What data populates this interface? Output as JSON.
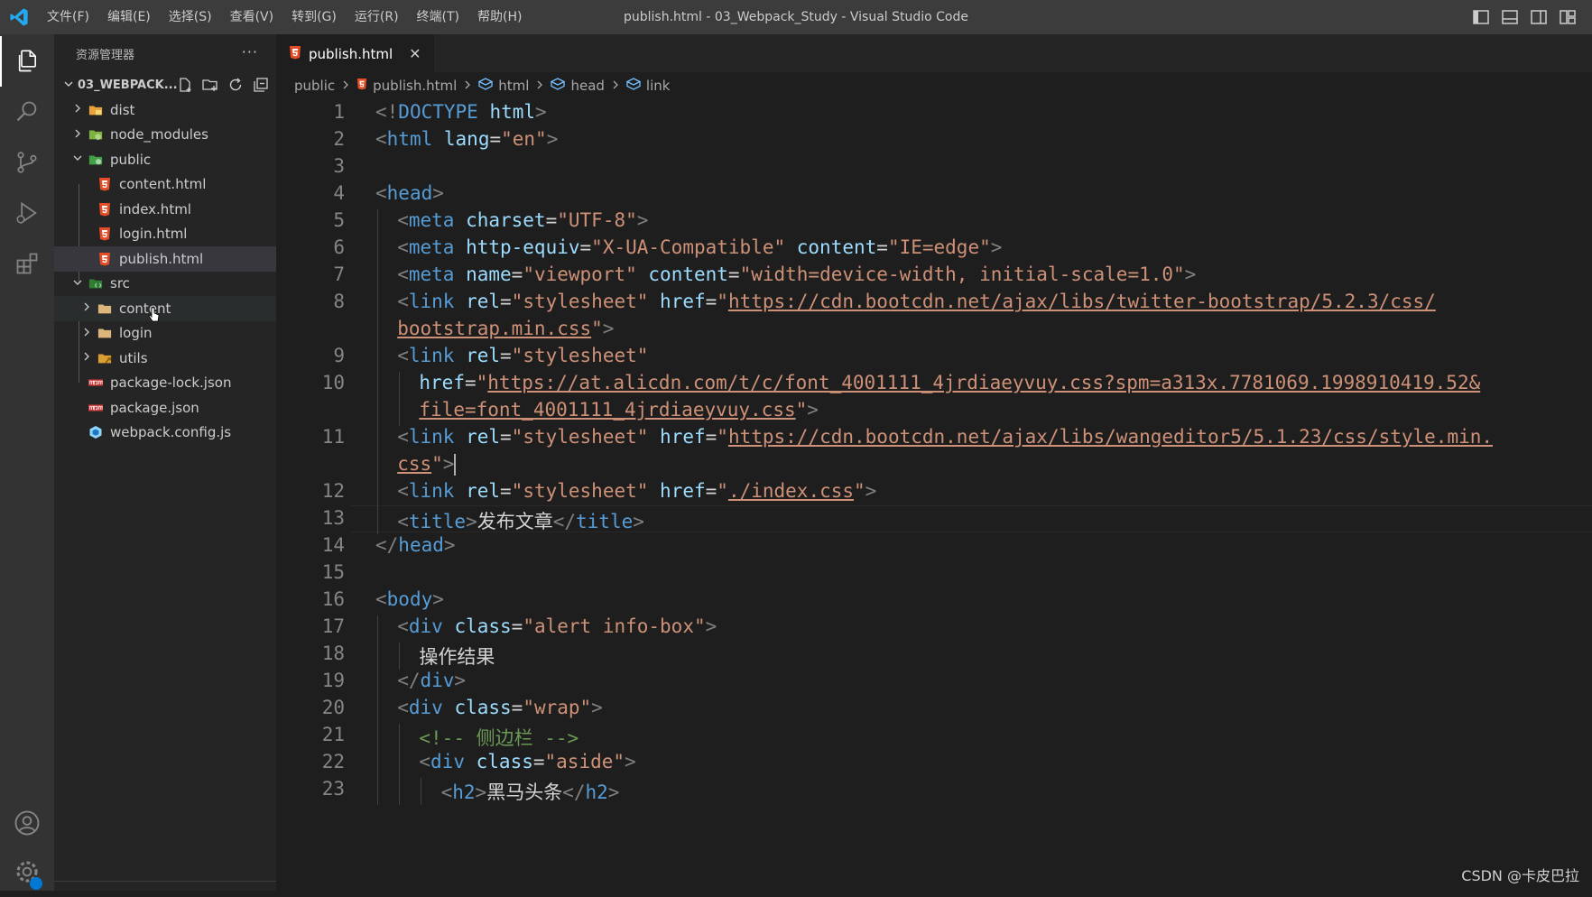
{
  "window": {
    "title": "publish.html - 03_Webpack_Study - Visual Studio Code",
    "menu": [
      "文件(F)",
      "编辑(E)",
      "选择(S)",
      "查看(V)",
      "转到(G)",
      "运行(R)",
      "终端(T)",
      "帮助(H)"
    ]
  },
  "sidebar": {
    "title": "资源管理器",
    "more": "···",
    "folder": "03_WEBPACK...",
    "tree": [
      {
        "label": "dist",
        "type": "folder-dist",
        "depth": 0,
        "expanded": false
      },
      {
        "label": "node_modules",
        "type": "folder-node",
        "depth": 0,
        "expanded": false
      },
      {
        "label": "public",
        "type": "folder-public",
        "depth": 0,
        "expanded": true
      },
      {
        "label": "content.html",
        "type": "html",
        "depth": 1
      },
      {
        "label": "index.html",
        "type": "html",
        "depth": 1
      },
      {
        "label": "login.html",
        "type": "html",
        "depth": 1
      },
      {
        "label": "publish.html",
        "type": "html",
        "depth": 1,
        "selected": true
      },
      {
        "label": "src",
        "type": "folder-src",
        "depth": 0,
        "expanded": true
      },
      {
        "label": "content",
        "type": "folder",
        "depth": 1,
        "expanded": false,
        "hover": true
      },
      {
        "label": "login",
        "type": "folder",
        "depth": 1,
        "expanded": false
      },
      {
        "label": "utils",
        "type": "folder-utils",
        "depth": 1,
        "expanded": false
      },
      {
        "label": "package-lock.json",
        "type": "npm",
        "depth": 0
      },
      {
        "label": "package.json",
        "type": "npm",
        "depth": 0
      },
      {
        "label": "webpack.config.js",
        "type": "webpack",
        "depth": 0
      }
    ]
  },
  "editor": {
    "tab": {
      "label": "publish.html",
      "close": "✕"
    },
    "breadcrumb": [
      "public",
      "publish.html",
      "html",
      "head",
      "link"
    ],
    "lines": [
      {
        "n": "1",
        "indent": 0,
        "tokens": [
          [
            "b",
            "<!"
          ],
          [
            "tag",
            "DOCTYPE"
          ],
          [
            "txt",
            " "
          ],
          [
            "attr",
            "html"
          ],
          [
            "b",
            ">"
          ]
        ]
      },
      {
        "n": "2",
        "indent": 0,
        "tokens": [
          [
            "b",
            "<"
          ],
          [
            "tag",
            "html"
          ],
          [
            "txt",
            " "
          ],
          [
            "attr",
            "lang"
          ],
          [
            "txt",
            "="
          ],
          [
            "str",
            "\"en\""
          ],
          [
            "b",
            ">"
          ]
        ]
      },
      {
        "n": "3",
        "indent": 0,
        "tokens": []
      },
      {
        "n": "4",
        "indent": 0,
        "tokens": [
          [
            "b",
            "<"
          ],
          [
            "tag",
            "head"
          ],
          [
            "b",
            ">"
          ]
        ]
      },
      {
        "n": "5",
        "indent": 1,
        "tokens": [
          [
            "b",
            "<"
          ],
          [
            "tag",
            "meta"
          ],
          [
            "txt",
            " "
          ],
          [
            "attr",
            "charset"
          ],
          [
            "txt",
            "="
          ],
          [
            "str",
            "\"UTF-8\""
          ],
          [
            "b",
            ">"
          ]
        ]
      },
      {
        "n": "6",
        "indent": 1,
        "tokens": [
          [
            "b",
            "<"
          ],
          [
            "tag",
            "meta"
          ],
          [
            "txt",
            " "
          ],
          [
            "attr",
            "http-equiv"
          ],
          [
            "txt",
            "="
          ],
          [
            "str",
            "\"X-UA-Compatible\""
          ],
          [
            "txt",
            " "
          ],
          [
            "attr",
            "content"
          ],
          [
            "txt",
            "="
          ],
          [
            "str",
            "\"IE=edge\""
          ],
          [
            "b",
            ">"
          ]
        ]
      },
      {
        "n": "7",
        "indent": 1,
        "tokens": [
          [
            "b",
            "<"
          ],
          [
            "tag",
            "meta"
          ],
          [
            "txt",
            " "
          ],
          [
            "attr",
            "name"
          ],
          [
            "txt",
            "="
          ],
          [
            "str",
            "\"viewport\""
          ],
          [
            "txt",
            " "
          ],
          [
            "attr",
            "content"
          ],
          [
            "txt",
            "="
          ],
          [
            "str",
            "\"width=device-width, initial-scale=1.0\""
          ],
          [
            "b",
            ">"
          ]
        ]
      },
      {
        "n": "8",
        "indent": 1,
        "tokens": [
          [
            "b",
            "<"
          ],
          [
            "tag",
            "link"
          ],
          [
            "txt",
            " "
          ],
          [
            "attr",
            "rel"
          ],
          [
            "txt",
            "="
          ],
          [
            "str",
            "\"stylesheet\""
          ],
          [
            "txt",
            " "
          ],
          [
            "attr",
            "href"
          ],
          [
            "txt",
            "="
          ],
          [
            "str",
            "\""
          ],
          [
            "url",
            "https://cdn.bootcdn.net/ajax/libs/twitter-bootstrap/5.2.3/css/"
          ]
        ]
      },
      {
        "n": "",
        "indent": 1,
        "tokens": [
          [
            "url",
            "bootstrap.min.css"
          ],
          [
            "str",
            "\""
          ],
          [
            "b",
            ">"
          ]
        ]
      },
      {
        "n": "9",
        "indent": 1,
        "tokens": [
          [
            "b",
            "<"
          ],
          [
            "tag",
            "link"
          ],
          [
            "txt",
            " "
          ],
          [
            "attr",
            "rel"
          ],
          [
            "txt",
            "="
          ],
          [
            "str",
            "\"stylesheet\""
          ]
        ]
      },
      {
        "n": "10",
        "indent": 2,
        "tokens": [
          [
            "attr",
            "href"
          ],
          [
            "txt",
            "="
          ],
          [
            "str",
            "\""
          ],
          [
            "url",
            "https://at.alicdn.com/t/c/font_4001111_4jrdiaeyvuy.css?spm=a313x.7781069.1998910419.52&"
          ]
        ]
      },
      {
        "n": "",
        "indent": 2,
        "tokens": [
          [
            "url",
            "file=font_4001111_4jrdiaeyvuy.css"
          ],
          [
            "str",
            "\""
          ],
          [
            "b",
            ">"
          ]
        ]
      },
      {
        "n": "11",
        "indent": 1,
        "tokens": [
          [
            "b",
            "<"
          ],
          [
            "tag",
            "link"
          ],
          [
            "txt",
            " "
          ],
          [
            "attr",
            "rel"
          ],
          [
            "txt",
            "="
          ],
          [
            "str",
            "\"stylesheet\""
          ],
          [
            "txt",
            " "
          ],
          [
            "attr",
            "href"
          ],
          [
            "txt",
            "="
          ],
          [
            "str",
            "\""
          ],
          [
            "url",
            "https://cdn.bootcdn.net/ajax/libs/wangeditor5/5.1.23/css/style.min."
          ]
        ]
      },
      {
        "n": "",
        "indent": 1,
        "cursor": true,
        "tokens": [
          [
            "url",
            "css"
          ],
          [
            "str",
            "\""
          ],
          [
            "b",
            ">"
          ]
        ]
      },
      {
        "n": "12",
        "indent": 1,
        "tokens": [
          [
            "b",
            "<"
          ],
          [
            "tag",
            "link"
          ],
          [
            "txt",
            " "
          ],
          [
            "attr",
            "rel"
          ],
          [
            "txt",
            "="
          ],
          [
            "str",
            "\"stylesheet\""
          ],
          [
            "txt",
            " "
          ],
          [
            "attr",
            "href"
          ],
          [
            "txt",
            "="
          ],
          [
            "str",
            "\""
          ],
          [
            "url",
            "./index.css"
          ],
          [
            "str",
            "\""
          ],
          [
            "b",
            ">"
          ]
        ]
      },
      {
        "n": "13",
        "indent": 1,
        "tokens": [
          [
            "b",
            "<"
          ],
          [
            "tag",
            "title"
          ],
          [
            "b",
            ">"
          ],
          [
            "txt",
            "发布文章"
          ],
          [
            "b",
            "</"
          ],
          [
            "tag",
            "title"
          ],
          [
            "b",
            ">"
          ]
        ]
      },
      {
        "n": "14",
        "indent": 0,
        "tokens": [
          [
            "b",
            "</"
          ],
          [
            "tag",
            "head"
          ],
          [
            "b",
            ">"
          ]
        ]
      },
      {
        "n": "15",
        "indent": 0,
        "tokens": []
      },
      {
        "n": "16",
        "indent": 0,
        "tokens": [
          [
            "b",
            "<"
          ],
          [
            "tag",
            "body"
          ],
          [
            "b",
            ">"
          ]
        ]
      },
      {
        "n": "17",
        "indent": 1,
        "tokens": [
          [
            "b",
            "<"
          ],
          [
            "tag",
            "div"
          ],
          [
            "txt",
            " "
          ],
          [
            "attr",
            "class"
          ],
          [
            "txt",
            "="
          ],
          [
            "str",
            "\"alert info-box\""
          ],
          [
            "b",
            ">"
          ]
        ]
      },
      {
        "n": "18",
        "indent": 2,
        "tokens": [
          [
            "txt",
            "操作结果"
          ]
        ]
      },
      {
        "n": "19",
        "indent": 1,
        "tokens": [
          [
            "b",
            "</"
          ],
          [
            "tag",
            "div"
          ],
          [
            "b",
            ">"
          ]
        ]
      },
      {
        "n": "20",
        "indent": 1,
        "tokens": [
          [
            "b",
            "<"
          ],
          [
            "tag",
            "div"
          ],
          [
            "txt",
            " "
          ],
          [
            "attr",
            "class"
          ],
          [
            "txt",
            "="
          ],
          [
            "str",
            "\"wrap\""
          ],
          [
            "b",
            ">"
          ]
        ]
      },
      {
        "n": "21",
        "indent": 2,
        "tokens": [
          [
            "cm",
            "<!-- 侧边栏 -->"
          ]
        ]
      },
      {
        "n": "22",
        "indent": 2,
        "tokens": [
          [
            "b",
            "<"
          ],
          [
            "tag",
            "div"
          ],
          [
            "txt",
            " "
          ],
          [
            "attr",
            "class"
          ],
          [
            "txt",
            "="
          ],
          [
            "str",
            "\"aside\""
          ],
          [
            "b",
            ">"
          ]
        ]
      },
      {
        "n": "23",
        "indent": 3,
        "tokens": [
          [
            "b",
            "<"
          ],
          [
            "tag",
            "h2"
          ],
          [
            "b",
            ">"
          ],
          [
            "txt",
            "黑马头条"
          ],
          [
            "b",
            "</"
          ],
          [
            "tag",
            "h2"
          ],
          [
            "b",
            ">"
          ]
        ]
      }
    ]
  },
  "watermark": "CSDN @卡皮巴拉"
}
